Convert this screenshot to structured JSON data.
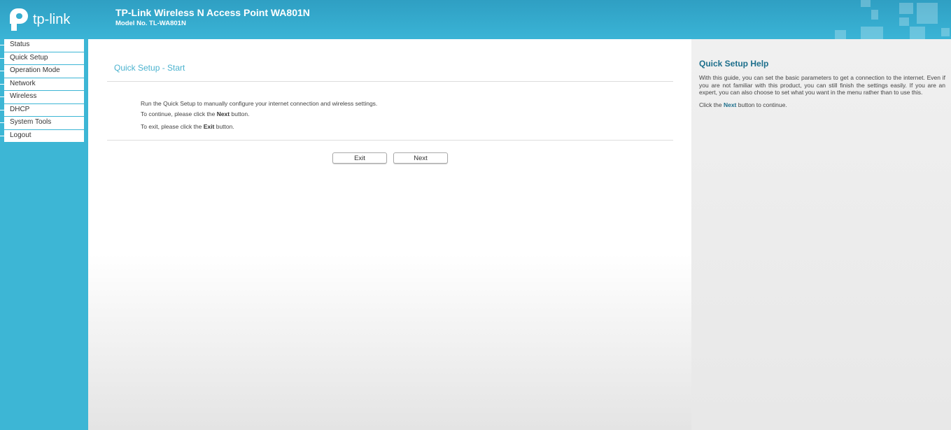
{
  "header": {
    "logo_text": "tp-link",
    "title": "TP-Link Wireless N Access Point WA801N",
    "model": "Model No. TL-WA801N"
  },
  "sidebar": {
    "items": [
      {
        "label": "Status"
      },
      {
        "label": "Quick Setup"
      },
      {
        "label": "Operation Mode"
      },
      {
        "label": "Network"
      },
      {
        "label": "Wireless"
      },
      {
        "label": "DHCP"
      },
      {
        "label": "System Tools"
      },
      {
        "label": "Logout"
      }
    ]
  },
  "main": {
    "title": "Quick Setup - Start",
    "line1": "Run the Quick Setup to manually configure your internet connection and wireless settings.",
    "line2_pre": "To continue, please click the ",
    "line2_bold": "Next",
    "line2_post": " button.",
    "line3_pre": "To exit, please click the ",
    "line3_bold": "Exit",
    "line3_post": " button.",
    "exit_label": "Exit",
    "next_label": "Next"
  },
  "help": {
    "title": "Quick Setup Help",
    "text": "With this guide, you can set the basic parameters to get a connection to the internet. Even if you are not familiar with this product, you can still finish the settings easily. If you are an expert, you can also choose to set what you want in the menu rather than to use this.",
    "next_pre": "Click the ",
    "next_bold": "Next",
    "next_post": " button to continue."
  }
}
